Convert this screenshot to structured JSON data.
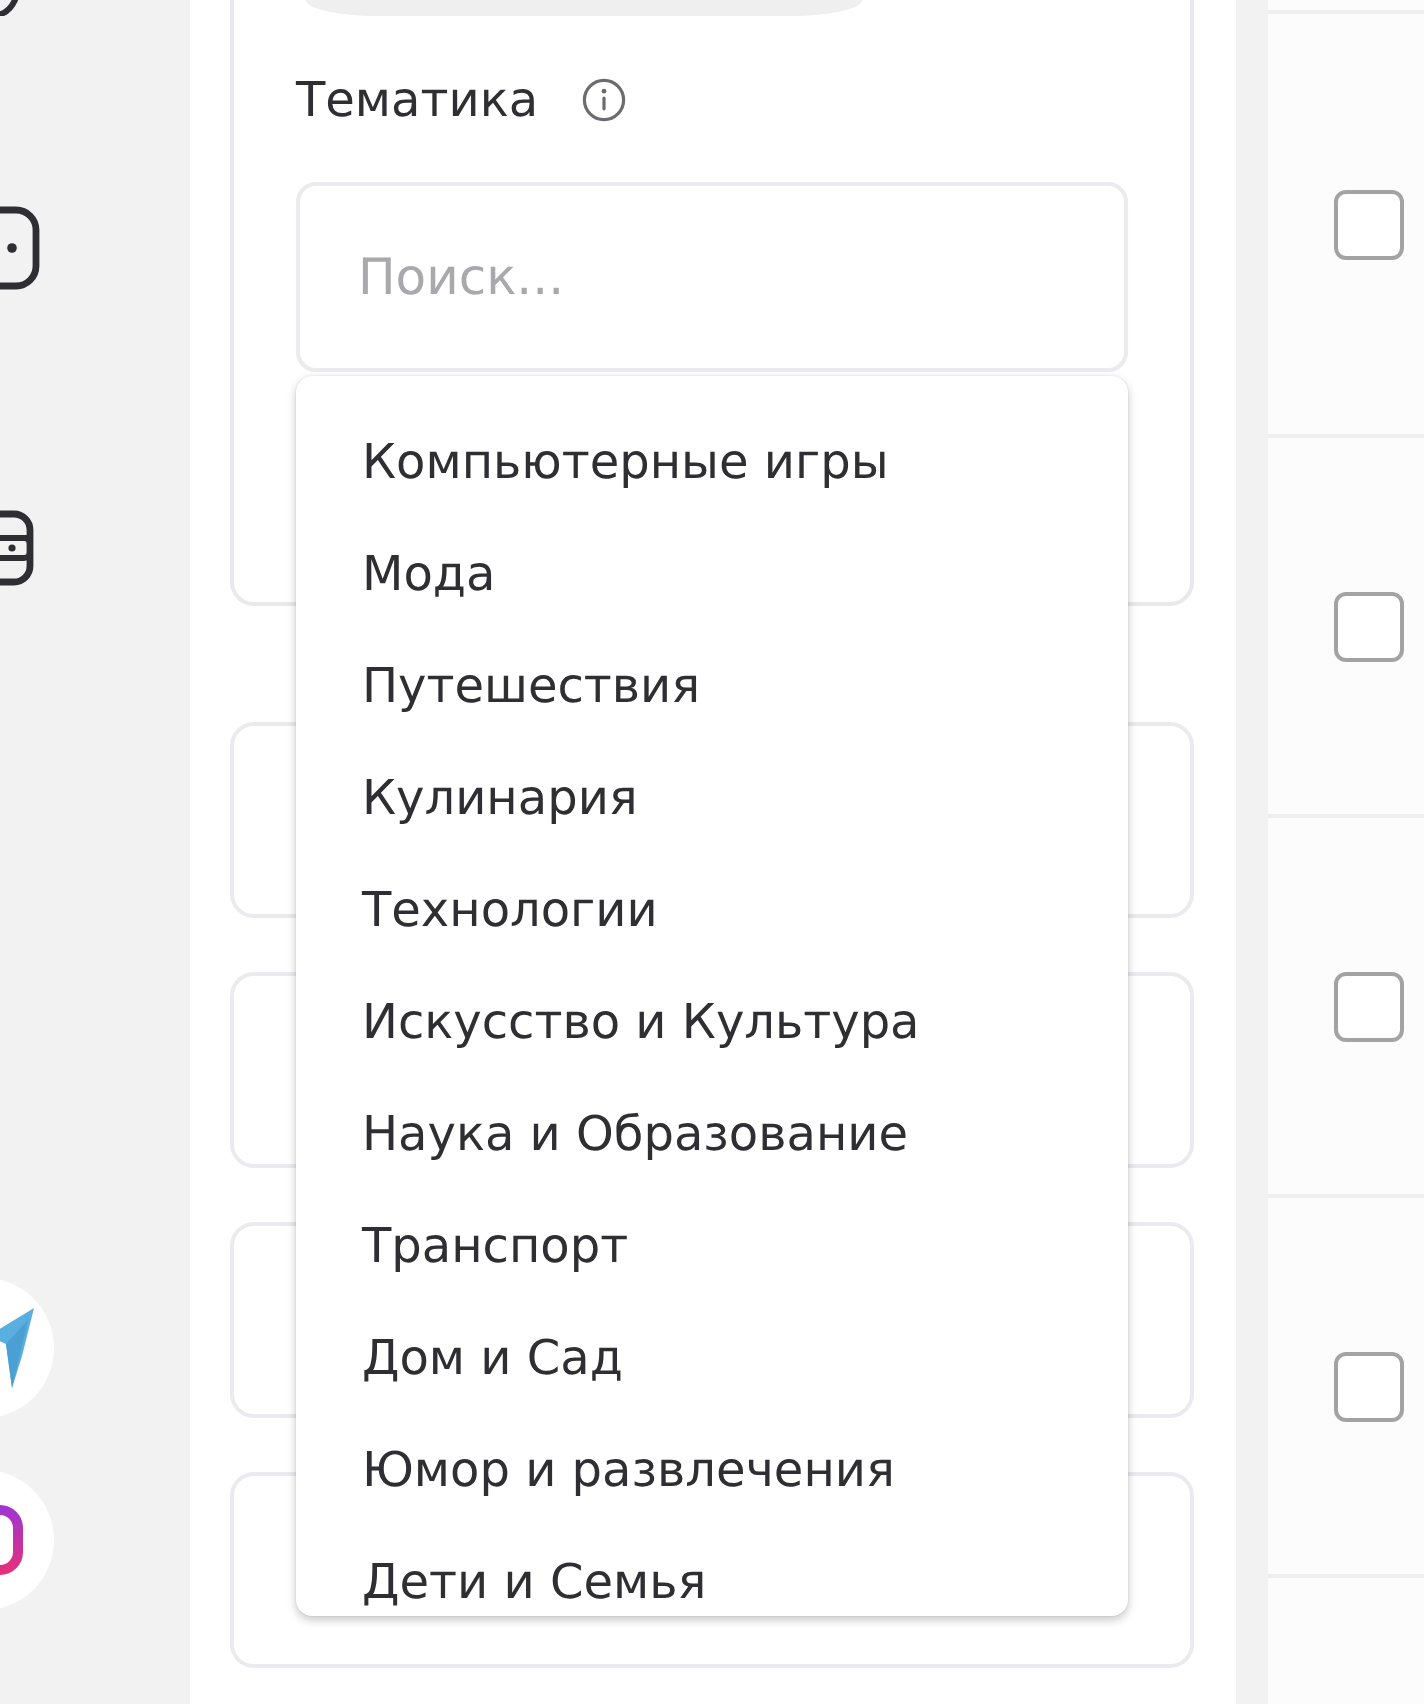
{
  "topic_filter": {
    "label": "Тематика",
    "search": {
      "placeholder": "Поиск..."
    },
    "dropdown": {
      "expanded": true,
      "options": [
        {
          "label": "Компьютерные игры",
          "selected": false
        },
        {
          "label": "Мода",
          "selected": false
        },
        {
          "label": "Путешествия",
          "selected": false
        },
        {
          "label": "Кулинария",
          "selected": false
        },
        {
          "label": "Технологии",
          "selected": false
        },
        {
          "label": "Искусство и Культура",
          "selected": false
        },
        {
          "label": "Наука и Образование",
          "selected": false
        },
        {
          "label": "Транспорт",
          "selected": false
        },
        {
          "label": "Дом и Сад",
          "selected": false
        },
        {
          "label": "Юмор и развлечения",
          "selected": false
        },
        {
          "label": "Дети и Семья",
          "selected": false
        }
      ]
    }
  },
  "list": {
    "rows": [
      {
        "checked": false
      },
      {
        "checked": false
      },
      {
        "checked": false
      },
      {
        "checked": false
      }
    ]
  }
}
